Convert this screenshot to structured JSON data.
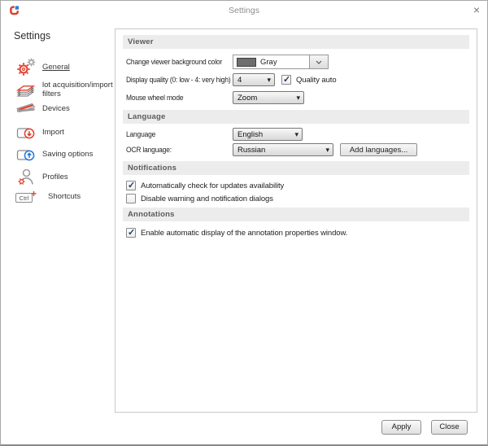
{
  "window": {
    "title": "Settings",
    "close_glyph": "×"
  },
  "sidebar": {
    "title": "Settings",
    "items": [
      {
        "label": "General",
        "icon": "gears-icon",
        "selected": true
      },
      {
        "label": "lot acquisition/import filters",
        "icon": "paper-stack-icon",
        "selected": false
      },
      {
        "label": "Devices",
        "icon": "scanner-icon",
        "selected": false
      },
      {
        "label": "Import",
        "icon": "import-arrow-icon",
        "selected": false
      },
      {
        "label": "Saving options",
        "icon": "save-arrow-icon",
        "selected": false
      },
      {
        "label": "Profiles",
        "icon": "user-gear-icon",
        "selected": false
      },
      {
        "label": "Shortcuts",
        "icon": "ctrl-key-icon",
        "selected": false
      }
    ],
    "shortcut_key_label": "Ctrl"
  },
  "sections": {
    "viewer": {
      "header": "Viewer",
      "bg_color_row": {
        "label": "Change viewer background color",
        "value": "Gray",
        "swatch_color": "#6e6e6e"
      },
      "quality_row": {
        "label": "Display quality (0: low - 4: very high)",
        "value": "4",
        "checkbox_label": "Quality auto",
        "checkbox_checked": true
      },
      "wheel_row": {
        "label": "Mouse wheel mode",
        "value": "Zoom"
      }
    },
    "language": {
      "header": "Language",
      "language_row": {
        "label": "Language",
        "value": "English"
      },
      "ocr_row": {
        "label": "OCR language:",
        "value": "Russian",
        "button_label": "Add languages..."
      }
    },
    "notifications": {
      "header": "Notifications",
      "updates_checkbox": {
        "label": "Automatically check for updates availability",
        "checked": true
      },
      "dialogs_checkbox": {
        "label": "Disable warning and notification dialogs",
        "checked": false
      }
    },
    "annotations": {
      "header": "Annotations",
      "annotation_checkbox": {
        "label": "Enable automatic display of the annotation properties window.",
        "checked": true
      }
    }
  },
  "footer": {
    "apply_label": "Apply",
    "close_label": "Close"
  },
  "colors": {
    "accent_red": "#e0402f",
    "accent_blue": "#2777d8",
    "section_band": "#ececec",
    "check_mark": "#1f3a5f"
  }
}
